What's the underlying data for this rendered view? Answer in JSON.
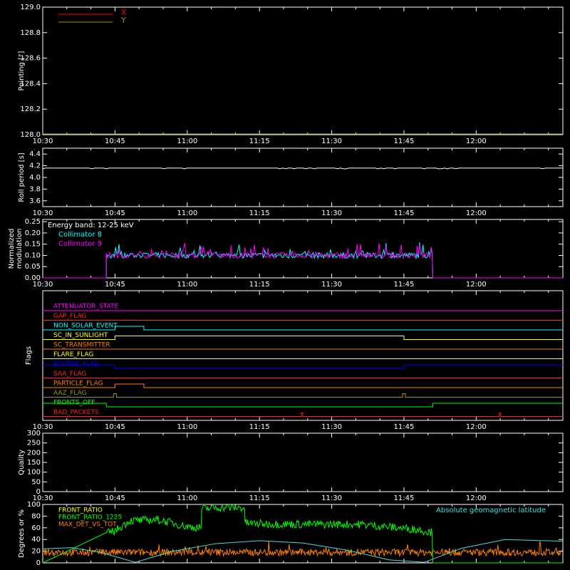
{
  "chart_data": [
    {
      "type": "line",
      "panel": "pointing",
      "ylabel": "Pointing [\"]",
      "ylim": [
        128.0,
        129.0
      ],
      "yticks": [
        "128.0",
        "128.2",
        "128.4",
        "128.6",
        "128.8",
        "129.0"
      ],
      "xticks": [
        "10:30",
        "10:45",
        "11:00",
        "11:15",
        "11:30",
        "11:45",
        "12:00"
      ],
      "legend": [
        {
          "label": "X",
          "color": "#ff0000"
        },
        {
          "label": "Y",
          "color": "#999900"
        }
      ],
      "series": [
        {
          "name": "X",
          "color": "#ff0000",
          "x": [
            10.5,
            12.3
          ],
          "y": [
            128.0,
            128.0
          ]
        },
        {
          "name": "Y",
          "color": "#999900",
          "x": [
            10.5,
            12.3
          ],
          "y": [
            128.0,
            128.0
          ]
        }
      ]
    },
    {
      "type": "line",
      "panel": "roll",
      "ylabel": "Roll period [s]",
      "ylim": [
        3.5,
        4.5
      ],
      "yticks": [
        "3.6",
        "3.8",
        "4.0",
        "4.2",
        "4.4"
      ],
      "xticks": [
        "10:30",
        "10:45",
        "11:00",
        "11:15",
        "11:30",
        "11:45",
        "12:00"
      ],
      "series": [
        {
          "name": "Roll period",
          "color": "#ffffff",
          "x": [
            10.5,
            12.3
          ],
          "y": [
            4.16,
            4.16
          ]
        }
      ]
    },
    {
      "type": "line",
      "panel": "modulation",
      "ylabel": "Normalized modulation",
      "ylim": [
        0.0,
        0.26
      ],
      "yticks": [
        "0.00",
        "0.05",
        "0.10",
        "0.15",
        "0.20",
        "0.25"
      ],
      "xticks": [
        "10:30",
        "10:45",
        "11:00",
        "11:15",
        "11:30",
        "11:45",
        "12:00"
      ],
      "annotation": "Energy band: 12-25 keV",
      "series": [
        {
          "name": "Collimator 8",
          "color": "#00ffff",
          "active": [
            10.72,
            11.85
          ],
          "baseline": 0.1,
          "noise": 0.025
        },
        {
          "name": "Collimator 9",
          "color": "#ff00ff",
          "active": [
            10.72,
            11.85
          ],
          "baseline": 0.1,
          "noise": 0.025
        }
      ]
    },
    {
      "type": "line",
      "panel": "flags",
      "ylabel": "Flags",
      "xticks": [
        "10:30",
        "10:45",
        "11:00",
        "11:15",
        "11:30",
        "11:45",
        "12:00"
      ],
      "flags": [
        {
          "name": "ATTENUATOR_STATE",
          "color": "#ff00ff",
          "steps": [
            [
              10.5,
              0
            ]
          ]
        },
        {
          "name": "GAP_FLAG",
          "color": "#ff2020",
          "steps": [
            [
              10.5,
              0
            ]
          ]
        },
        {
          "name": "NON_SOLAR_EVENT",
          "color": "#00ffff",
          "steps": [
            [
              10.5,
              0
            ],
            [
              10.75,
              1
            ],
            [
              10.85,
              0
            ]
          ]
        },
        {
          "name": "SC_IN_SUNLIGHT",
          "color": "#ffff00",
          "steps": [
            [
              10.5,
              0
            ],
            [
              10.75,
              1
            ],
            [
              11.75,
              0
            ]
          ]
        },
        {
          "name": "SC_TRANSMITTER",
          "color": "#ff8000",
          "steps": [
            [
              10.5,
              0
            ]
          ]
        },
        {
          "name": "FLARE_FLAG",
          "color": "#ffff00",
          "steps": [
            [
              10.5,
              0
            ]
          ]
        },
        {
          "name": "ECLIPSE_FLAG",
          "color": "#0000ff",
          "steps": [
            [
              10.5,
              1
            ],
            [
              10.75,
              0
            ],
            [
              11.75,
              1
            ]
          ]
        },
        {
          "name": "SAA_FLAG",
          "color": "#ff2020",
          "steps": [
            [
              10.5,
              0
            ]
          ]
        },
        {
          "name": "PARTICLE_FLAG",
          "color": "#ff8000",
          "steps": [
            [
              10.5,
              0
            ],
            [
              10.75,
              1
            ],
            [
              10.85,
              0
            ]
          ]
        },
        {
          "name": "AAZ_FLAG",
          "color": "#999900",
          "steps": [
            [
              10.5,
              0
            ],
            [
              10.745,
              1
            ],
            [
              10.755,
              0
            ],
            [
              11.745,
              1
            ],
            [
              11.755,
              0
            ]
          ]
        },
        {
          "name": "FRONTS_OFF",
          "color": "#00ff00",
          "steps": [
            [
              10.5,
              1
            ],
            [
              10.72,
              0
            ],
            [
              11.85,
              1
            ]
          ]
        },
        {
          "name": "BAD_PACKETS",
          "color": "#ff2020",
          "steps": [
            [
              10.5,
              0
            ],
            [
              11.395,
              1
            ],
            [
              11.4,
              0
            ],
            [
              12.08,
              1
            ],
            [
              12.085,
              0
            ]
          ]
        }
      ]
    },
    {
      "type": "line",
      "panel": "quality",
      "ylabel": "Quality",
      "ylim": [
        0,
        300
      ],
      "yticks": [
        "0",
        "50",
        "100",
        "150",
        "200",
        "250",
        "300"
      ],
      "xticks": [
        "10:30",
        "10:45",
        "11:00",
        "11:15",
        "11:30",
        "11:45",
        "12:00"
      ],
      "series": []
    },
    {
      "type": "line",
      "panel": "ratios",
      "ylabel": "Degrees or %",
      "ylim": [
        0,
        100
      ],
      "yticks": [
        "0",
        "20",
        "40",
        "60",
        "80",
        "100"
      ],
      "xticks": [],
      "legend": [
        {
          "label": "FRONT_RATIO",
          "color": "#ffff00"
        },
        {
          "label": "FRONT_RATIO_1225",
          "color": "#00ff00"
        },
        {
          "label": "MAX_DET_VS_TOT",
          "color": "#ff8000"
        }
      ],
      "right_legend": {
        "label": "Absolute geomagnetic latitude",
        "color": "#40e0e0"
      },
      "series": [
        {
          "name": "FRONT_RATIO_1225",
          "color": "#00ff00",
          "segments": [
            {
              "x": [
                10.72,
                10.75,
                10.8,
                10.9,
                11.0,
                11.05
              ],
              "y": [
                50,
                55,
                72,
                74,
                62,
                60
              ]
            },
            {
              "x": [
                11.05,
                11.1,
                11.2
              ],
              "y": [
                92,
                95,
                94
              ]
            },
            {
              "x": [
                11.2,
                11.25,
                11.4,
                11.6,
                11.8,
                11.85
              ],
              "y": [
                68,
                67,
                66,
                66,
                57,
                52
              ]
            }
          ]
        },
        {
          "name": "MAX_DET_VS_TOT",
          "color": "#ff8000",
          "baseline": 18,
          "noise": 6
        },
        {
          "name": "Absolute geomagnetic latitude",
          "color": "#40e0e0",
          "x": [
            10.5,
            10.6,
            10.7,
            10.82,
            10.95,
            11.1,
            11.25,
            11.4,
            11.55,
            11.7,
            11.82,
            11.95,
            12.1,
            12.3
          ],
          "y": [
            24,
            26,
            18,
            1,
            20,
            33,
            38,
            34,
            22,
            5,
            1,
            25,
            40,
            37
          ]
        }
      ]
    }
  ]
}
